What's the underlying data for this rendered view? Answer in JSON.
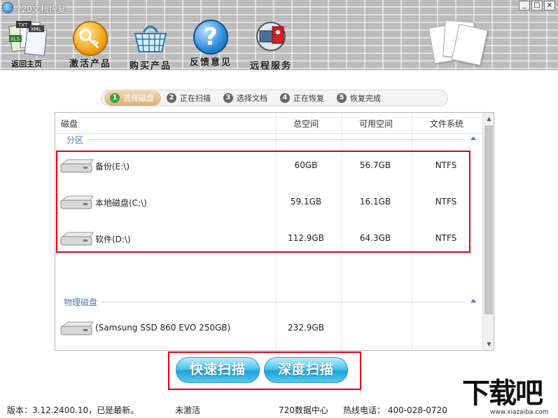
{
  "window": {
    "title": "720文档恢复",
    "controls": [
      "_",
      "□",
      "×"
    ]
  },
  "toolbar": {
    "home_label": "返回主页",
    "home_icon_tags": [
      "TXT",
      "XML",
      "XLS"
    ],
    "items": [
      {
        "label": "激活产品",
        "icon": "key-icon"
      },
      {
        "label": "购买产品",
        "icon": "basket-icon"
      },
      {
        "label": "反馈意见",
        "icon": "help-icon",
        "glyph": "?"
      },
      {
        "label": "远程服务",
        "icon": "remote-service-icon"
      }
    ]
  },
  "steps": [
    {
      "num": "1",
      "label": "选择磁盘",
      "active": true
    },
    {
      "num": "2",
      "label": "正在扫描",
      "active": false
    },
    {
      "num": "3",
      "label": "选择文档",
      "active": false
    },
    {
      "num": "4",
      "label": "正在恢复",
      "active": false
    },
    {
      "num": "5",
      "label": "恢复完成",
      "active": false
    }
  ],
  "table": {
    "headers": [
      "磁盘",
      "总空间",
      "可用空间",
      "文件系统"
    ],
    "partition_section": "分区",
    "partitions": [
      {
        "name": "备份(E:\\)",
        "total": "60GB",
        "free": "56.7GB",
        "fs": "NTFS"
      },
      {
        "name": "本地磁盘(C:\\)",
        "total": "59.1GB",
        "free": "16.1GB",
        "fs": "NTFS"
      },
      {
        "name": "软件(D:\\)",
        "total": "112.9GB",
        "free": "64.3GB",
        "fs": "NTFS"
      }
    ],
    "physical_section": "物理磁盘",
    "physical": [
      {
        "name": "(Samsung SSD 860 EVO 250GB)",
        "total": "232.9GB",
        "free": "",
        "fs": ""
      }
    ]
  },
  "buttons": {
    "quick_scan": "快速扫描",
    "deep_scan": "深度扫描"
  },
  "status": {
    "version": "版本：3.12.2400.10，已是最新。",
    "activation": "未激活",
    "data_center": "720数据中心",
    "hotline": "热线电话：  400-028-0720"
  },
  "watermark": {
    "text": "下载吧",
    "url": "www.xiazaiba.com"
  },
  "colors": {
    "highlight_red": "#e2000f",
    "button_blue": "#1fa3d8",
    "step_active": "#ddb07a",
    "section_blue": "#4a7ab5"
  }
}
